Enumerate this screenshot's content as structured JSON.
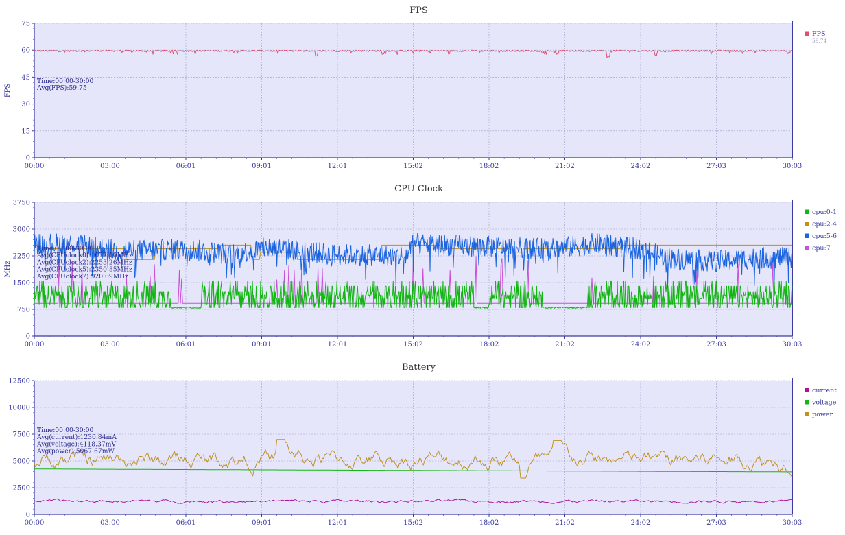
{
  "colors": {
    "plot_bg": "#e6e6fa",
    "axis": "#3a3aa0",
    "grid": "#9a9ac8",
    "fps": "#e0506e",
    "cpu01": "#12b512",
    "cpu24": "#c09018",
    "cpu56": "#1a64e0",
    "cpu7": "#c850d8",
    "current": "#b0109a",
    "voltage": "#12b512",
    "power": "#c09020"
  },
  "chart_data": [
    {
      "type": "line",
      "title": "FPS",
      "ylabel": "FPS",
      "ylim": [
        0,
        75
      ],
      "yticks": [
        "0",
        "15",
        "30",
        "45",
        "60",
        "75"
      ],
      "xticks": [
        "00:00",
        "03:00",
        "06:01",
        "09:01",
        "12:01",
        "15:02",
        "18:02",
        "21:02",
        "24:02",
        "27:03",
        "30:03"
      ],
      "annotation": [
        "Time:00:00-30:00",
        "Avg(FPS):59.75"
      ],
      "series": [
        {
          "name": "FPS",
          "sub": "59.74",
          "color_key": "fps",
          "base": [
            59.6,
            59.6
          ],
          "noise": 0.6,
          "dips": [
            [
              0.372,
              56
            ],
            [
              0.46,
              57
            ],
            [
              0.69,
              57
            ],
            [
              0.757,
              56
            ],
            [
              0.82,
              57
            ],
            [
              0.995,
              58
            ]
          ],
          "values_note": ""
        }
      ]
    },
    {
      "type": "line",
      "title": "CPU Clock",
      "ylabel": "MHz",
      "ylim": [
        0,
        3750
      ],
      "yticks": [
        "0",
        "750",
        "1500",
        "2250",
        "3000",
        "3750"
      ],
      "xticks": [
        "00:00",
        "03:00",
        "06:01",
        "09:01",
        "12:01",
        "15:02",
        "18:02",
        "21:02",
        "24:02",
        "27:03",
        "30:03"
      ],
      "annotation": [
        "Time:00:00-30:00",
        "Avg(CPUclock0):1072.10MHz",
        "Avg(CPUclock2):2253.26MHz",
        "Avg(CPUclock5):2350.85MHz",
        "Avg(CPUclock7):920.09MHz"
      ],
      "series": [
        {
          "name": "cpu:0-1",
          "color_key": "cpu01"
        },
        {
          "name": "cpu:2-4",
          "color_key": "cpu24"
        },
        {
          "name": "cpu:5-6",
          "color_key": "cpu56"
        },
        {
          "name": "cpu:7",
          "color_key": "cpu7"
        }
      ]
    },
    {
      "type": "line",
      "title": "Battery",
      "ylabel": "",
      "ylim": [
        0,
        12500
      ],
      "yticks": [
        "0",
        "2500",
        "5000",
        "7500",
        "10000",
        "12500"
      ],
      "xticks": [
        "00:00",
        "03:00",
        "06:01",
        "09:01",
        "12:01",
        "15:02",
        "18:02",
        "21:02",
        "24:02",
        "27:03",
        "30:03"
      ],
      "annotation": [
        "Time:00:00-30:00",
        "Avg(current):1230.84mA",
        "Avg(voltage):4118.37mV",
        "Avg(power):5067.67mW"
      ],
      "series": [
        {
          "name": "current",
          "color_key": "current"
        },
        {
          "name": "voltage",
          "color_key": "voltage"
        },
        {
          "name": "power",
          "color_key": "power"
        }
      ]
    }
  ]
}
